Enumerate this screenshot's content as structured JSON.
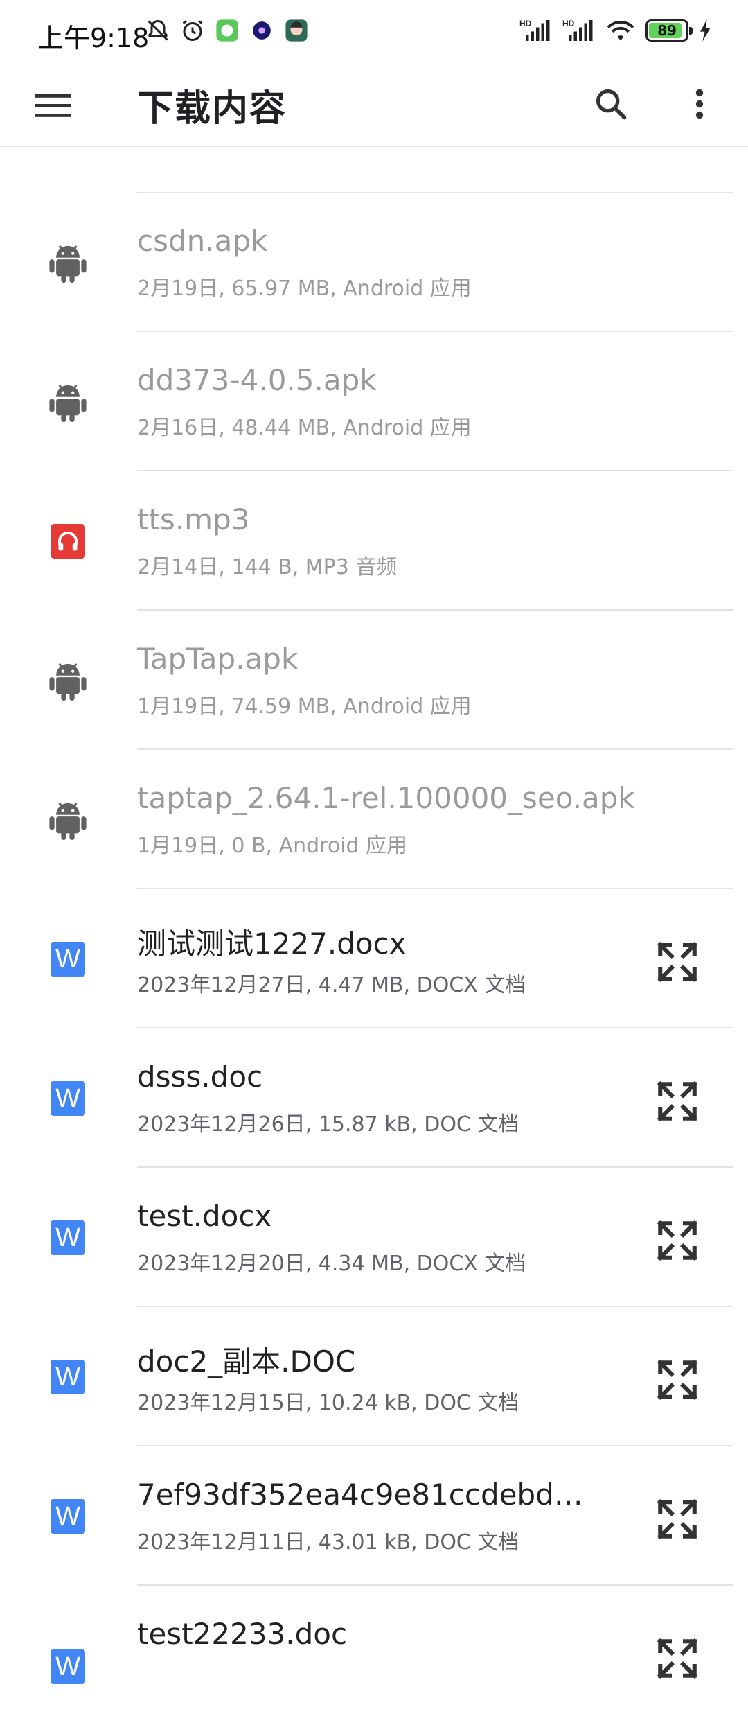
{
  "status_bar": {
    "time": "上午9:18",
    "battery": "89",
    "signal_label_1": "HD",
    "signal_label_2": "HD"
  },
  "app_bar": {
    "title": "下载内容",
    "menu_icon": "hamburger-menu-icon",
    "search_icon": "search-icon",
    "more_icon": "more-vert-icon"
  },
  "files": [
    {
      "name": "csdn.apk",
      "meta": "2月19日, 65.97 MB, Android 应用",
      "icon": "android-icon",
      "dim": true
    },
    {
      "name": "dd373-4.0.5.apk",
      "meta": "2月16日, 48.44 MB, Android 应用",
      "icon": "android-icon",
      "dim": true
    },
    {
      "name": "tts.mp3",
      "meta": "2月14日, 144 B, MP3 音频",
      "icon": "audio-icon",
      "dim": true
    },
    {
      "name": "TapTap.apk",
      "meta": "1月19日, 74.59 MB, Android 应用",
      "icon": "android-icon",
      "dim": true
    },
    {
      "name": "taptap_2.64.1-rel.100000_seo.apk",
      "meta": "1月19日, 0 B, Android 应用",
      "icon": "android-icon",
      "dim": true
    },
    {
      "name": "测试测试1227.docx",
      "meta": "2023年12月27日, 4.47 MB, DOCX 文档",
      "icon": "word-icon",
      "dim": false
    },
    {
      "name": "dsss.doc",
      "meta": "2023年12月26日, 15.87 kB, DOC 文档",
      "icon": "word-icon",
      "dim": false
    },
    {
      "name": "test.docx",
      "meta": "2023年12月20日, 4.34 MB, DOCX 文档",
      "icon": "word-icon",
      "dim": false
    },
    {
      "name": "doc2_副本.DOC",
      "meta": "2023年12月15日, 10.24 kB, DOC 文档",
      "icon": "word-icon",
      "dim": false
    },
    {
      "name": "7ef93df352ea4c9e81ccdebd…",
      "meta": "2023年12月11日, 43.01 kB, DOC 文档",
      "icon": "word-icon",
      "dim": false
    },
    {
      "name": "test22233.doc",
      "meta": "",
      "icon": "word-icon",
      "dim": false
    }
  ],
  "word_icon_letter": "W",
  "colors": {
    "word": "#4285f4",
    "audio": "#e53935",
    "android": "#616161"
  }
}
